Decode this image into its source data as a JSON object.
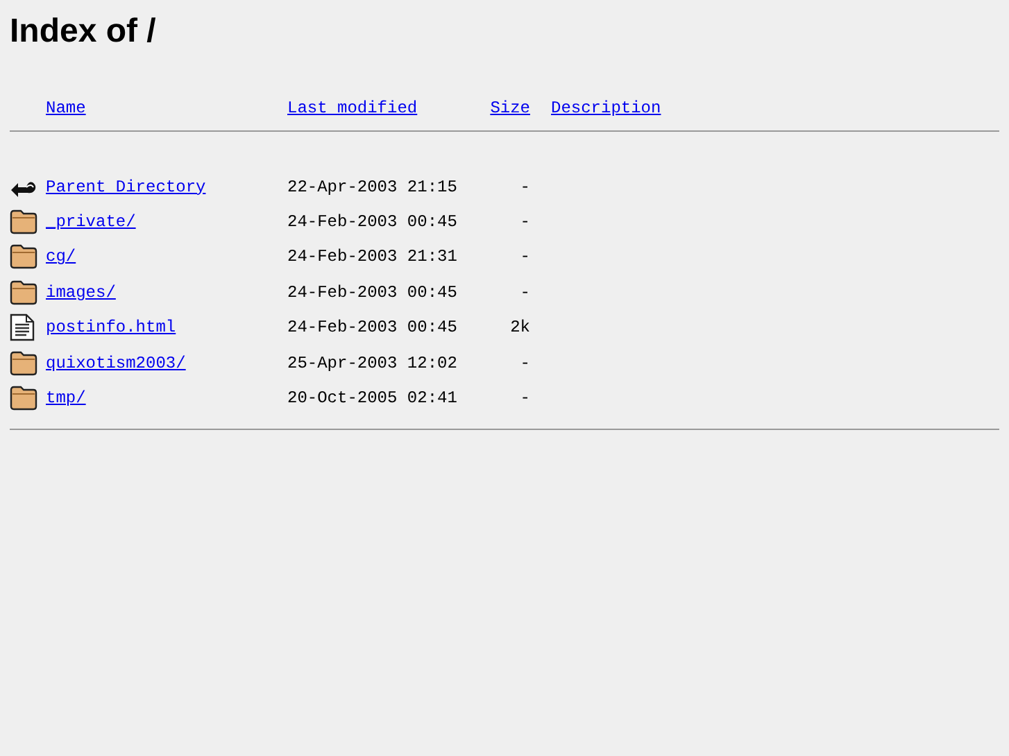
{
  "title": "Index of /",
  "columns": [
    {
      "label": "Name"
    },
    {
      "label": "Last modified"
    },
    {
      "label": "Size"
    },
    {
      "label": "Description"
    }
  ],
  "rows": [
    {
      "kind": "parent",
      "name": "Parent Directory",
      "modified": "22-Apr-2003 21:15",
      "size": "-"
    },
    {
      "kind": "folder",
      "name": "_private/",
      "modified": "24-Feb-2003 00:45",
      "size": "-"
    },
    {
      "kind": "folder",
      "name": "cg/",
      "modified": "24-Feb-2003 21:31",
      "size": "-"
    },
    {
      "kind": "folder",
      "name": "images/",
      "modified": "24-Feb-2003 00:45",
      "size": "-"
    },
    {
      "kind": "file",
      "name": "postinfo.html",
      "modified": "24-Feb-2003 00:45",
      "size": "2k"
    },
    {
      "kind": "folder",
      "name": "quixotism2003/",
      "modified": "25-Apr-2003 12:02",
      "size": "-"
    },
    {
      "kind": "folder",
      "name": "tmp/",
      "modified": "20-Oct-2005 02:41",
      "size": "-"
    }
  ]
}
